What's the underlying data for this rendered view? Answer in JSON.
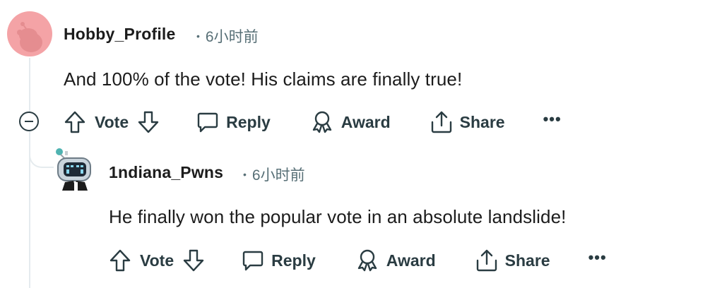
{
  "comments": [
    {
      "username": "Hobby_Profile",
      "time": "6小时前",
      "text": "And 100% of the vote! His claims are finally true!",
      "avatar_icon": "snoo-avatar-icon",
      "avatar_bg": "#f4a3a6"
    },
    {
      "username": "1ndiana_Pwns",
      "time": "6小时前",
      "text": "He finally won the popular vote in an absolute landslide!",
      "avatar_icon": "robot-avatar-icon",
      "avatar_bg": "#ffffff"
    }
  ],
  "actions": {
    "vote": "Vote",
    "reply": "Reply",
    "award": "Award",
    "share": "Share",
    "more": "•••"
  },
  "meta_dot": "•"
}
